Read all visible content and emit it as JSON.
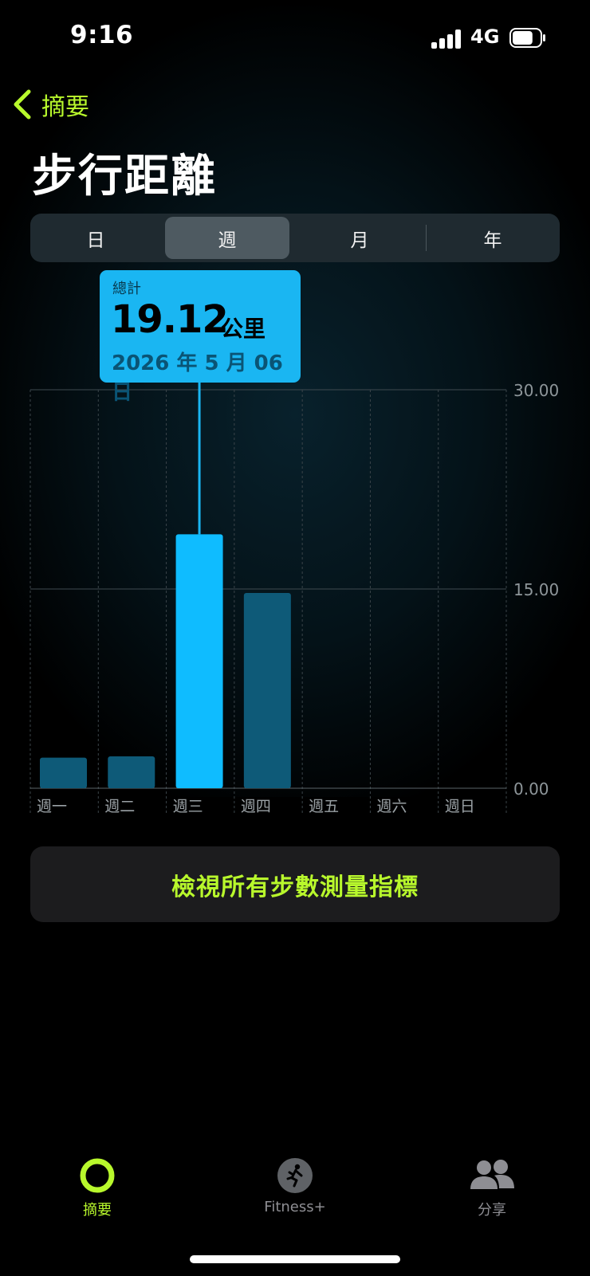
{
  "status_bar": {
    "time": "9:16",
    "network": "4G",
    "battery_level": 0.75
  },
  "nav": {
    "back_label": "摘要"
  },
  "page": {
    "title": "步行距離"
  },
  "segments": [
    {
      "label": "日",
      "selected": false
    },
    {
      "label": "週",
      "selected": true
    },
    {
      "label": "月",
      "selected": false
    },
    {
      "label": "年",
      "selected": false
    }
  ],
  "tooltip": {
    "label": "總計",
    "value": "19.12",
    "unit": "公里",
    "date": "2026 年 5 月 06 日"
  },
  "colors": {
    "accent": "#b8f82c",
    "bar_selected": "#0fbcff",
    "bar_other": "#0e5a78",
    "tooltip_bg": "#1ab6f2"
  },
  "chart_data": {
    "type": "bar",
    "categories": [
      "週一",
      "週二",
      "週三",
      "週四",
      "週五",
      "週六",
      "週日"
    ],
    "values": [
      2.3,
      2.4,
      19.12,
      14.7,
      0,
      0,
      0
    ],
    "selected_index": 2,
    "ylim": [
      0,
      30
    ],
    "yticks": [
      {
        "value": 0,
        "label": "0.00"
      },
      {
        "value": 15,
        "label": "15.00"
      },
      {
        "value": 30,
        "label": "30.00"
      }
    ],
    "grid": true
  },
  "actions": {
    "view_all_metrics": "檢視所有步數測量指標"
  },
  "tab_bar": {
    "items": [
      {
        "label": "摘要",
        "icon": "activity-ring-icon",
        "active": true
      },
      {
        "label": "Fitness+",
        "icon": "running-figure-icon",
        "active": false
      },
      {
        "label": "分享",
        "icon": "people-icon",
        "active": false
      }
    ]
  }
}
